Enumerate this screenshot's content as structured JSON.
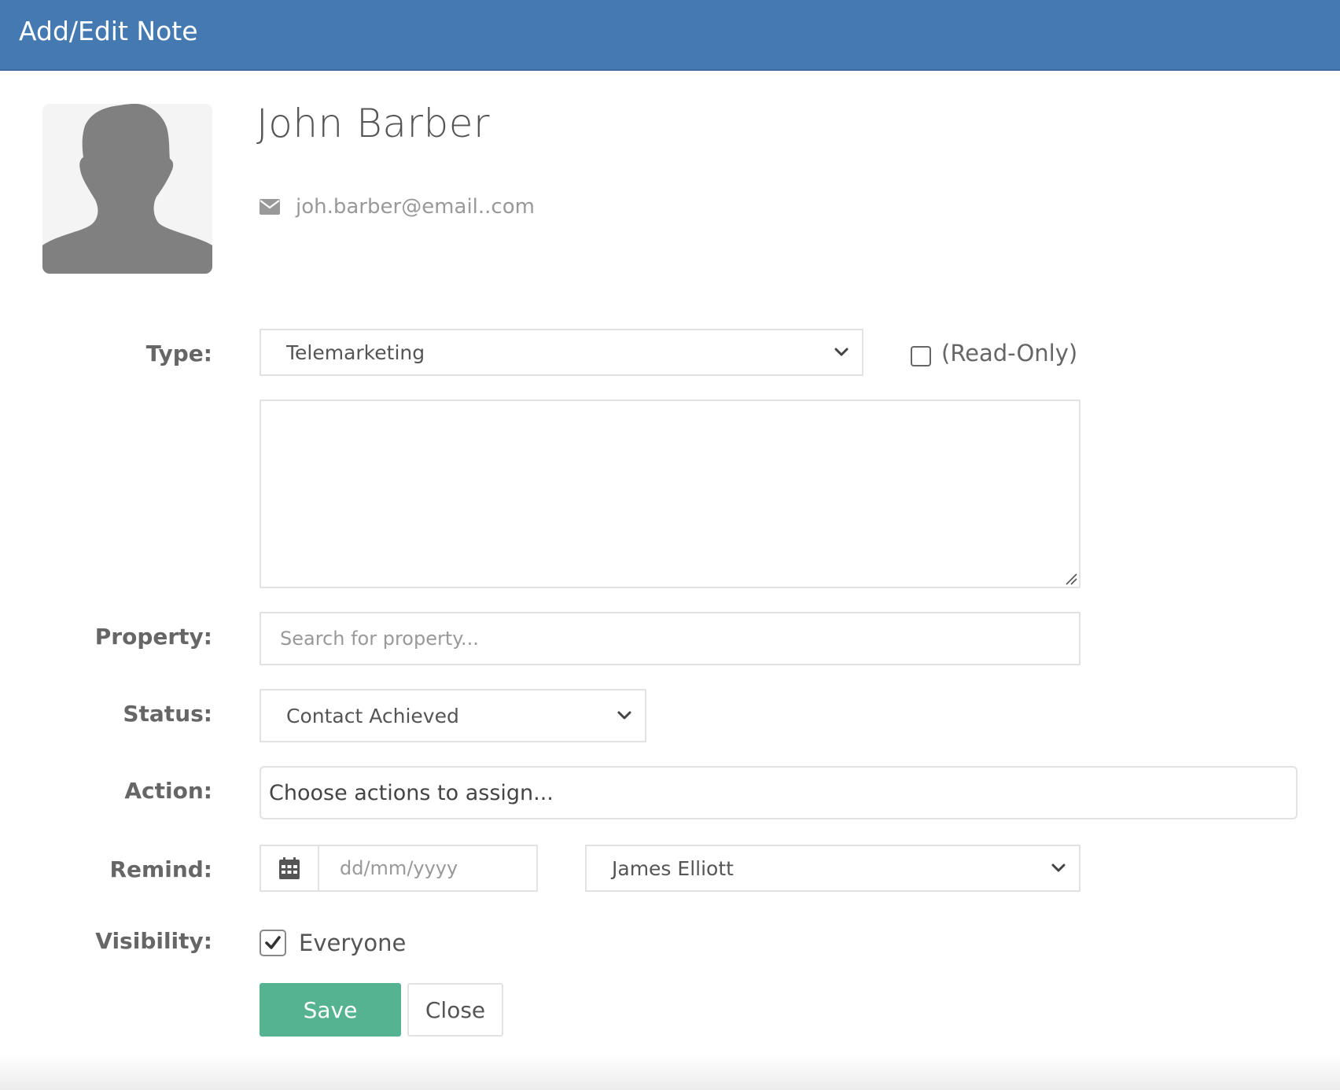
{
  "header": {
    "title": "Add/Edit Note"
  },
  "contact": {
    "name": "John Barber",
    "email": "joh.barber@email..com"
  },
  "form": {
    "type": {
      "label": "Type:",
      "value": "Telemarketing"
    },
    "read_only": {
      "label": "(Read-Only)",
      "checked": false
    },
    "note_text": "",
    "property": {
      "label": "Property:",
      "placeholder": "Search for property..."
    },
    "status": {
      "label": "Status:",
      "value": "Contact Achieved"
    },
    "action": {
      "label": "Action:",
      "placeholder": "Choose actions to assign..."
    },
    "remind": {
      "label": "Remind:",
      "date_placeholder": "dd/mm/yyyy",
      "user": "James Elliott"
    },
    "visibility": {
      "label": "Visibility:",
      "option": "Everyone",
      "checked": true
    }
  },
  "buttons": {
    "save": "Save",
    "close": "Close"
  },
  "colors": {
    "header_bg": "#4579b2",
    "save_bg": "#55b391",
    "avatar_silhouette": "#808080",
    "border": "#e2e2e2"
  },
  "icons": [
    "avatar-silhouette",
    "envelope-icon",
    "chevron-down-icon",
    "calendar-icon",
    "checkmark-icon"
  ]
}
